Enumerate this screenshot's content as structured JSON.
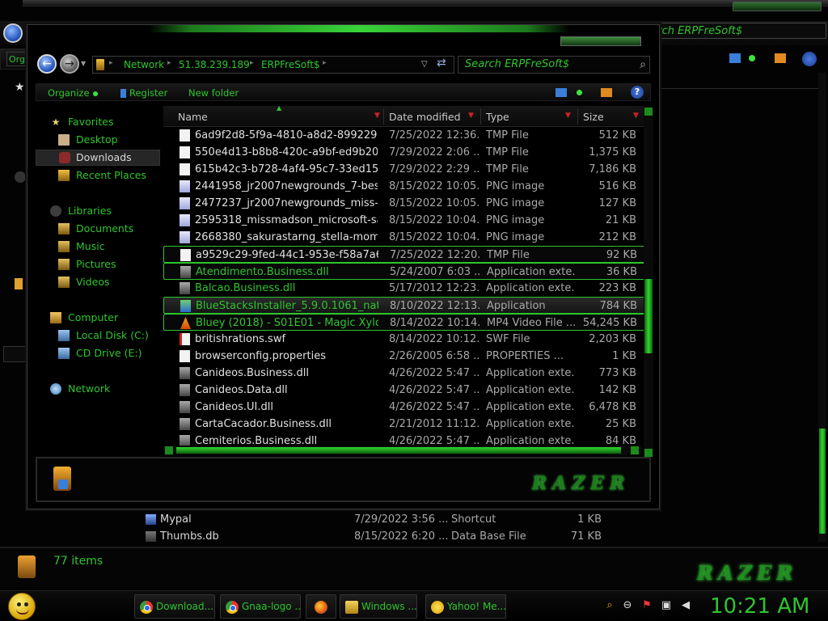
{
  "background_window": {
    "search_text": "Search ERPFreSoft$",
    "organize_fragment": "Org",
    "status_count": "77 items",
    "logo_text": "RAZER",
    "files": [
      {
        "name": "Mypal",
        "date": "7/29/2022 3:56 ...",
        "type": "Shortcut",
        "size": "1 KB"
      },
      {
        "name": "Thumbs.db",
        "date": "8/15/2022 6:20 ...",
        "type": "Data Base File",
        "size": "71 KB"
      }
    ]
  },
  "window": {
    "address": {
      "crumbs": [
        "Network",
        "51.38.239.189",
        "ERPFreSoft$"
      ]
    },
    "search_placeholder": "Search ERPFreSoft$",
    "toolbar": {
      "organize": "Organize",
      "register": "Register",
      "new_folder": "New folder",
      "help": "?"
    },
    "nav": {
      "favorites": "Favorites",
      "desktop": "Desktop",
      "downloads": "Downloads",
      "recent": "Recent Places",
      "libraries": "Libraries",
      "documents": "Documents",
      "music": "Music",
      "pictures": "Pictures",
      "videos": "Videos",
      "computer": "Computer",
      "local_disk": "Local Disk (C:)",
      "cd_drive": "CD Drive (E:)",
      "network": "Network"
    },
    "columns": {
      "name": "Name",
      "date": "Date modified",
      "type": "Type",
      "size": "Size"
    },
    "files": [
      {
        "name": "6ad9f2d8-5f9a-4810-a8d2-899229a42...",
        "date": "7/25/2022 12:36...",
        "type": "TMP File",
        "size": "512 KB"
      },
      {
        "name": "550e4d13-b8b8-420c-a9bf-ed9b206a...",
        "date": "7/29/2022 2:06 ...",
        "type": "TMP File",
        "size": "1,375 KB"
      },
      {
        "name": "615b42c3-b728-4af4-95c7-33ed1561...",
        "date": "7/29/2022 2:29 ...",
        "type": "TMP File",
        "size": "7,186 KB"
      },
      {
        "name": "2441958_jr2007newgrounds_7-bestie...",
        "date": "8/15/2022 10:05...",
        "type": "PNG image",
        "size": "516 KB"
      },
      {
        "name": "2477237_jr2007newgrounds_miss-m...",
        "date": "8/15/2022 10:05...",
        "type": "PNG image",
        "size": "127 KB"
      },
      {
        "name": "2595318_missmadson_microsoft-sa...",
        "date": "8/15/2022 10:04...",
        "type": "PNG image",
        "size": "21 KB"
      },
      {
        "name": "2668380_sakurastarng_stella-momo...",
        "date": "8/15/2022 10:04...",
        "type": "PNG image",
        "size": "212 KB"
      },
      {
        "name": "a9529c29-9fed-44c1-953e-f58a7a61...",
        "date": "7/25/2022 12:20...",
        "type": "TMP File",
        "size": "92 KB"
      },
      {
        "name": "Atendimento.Business.dll",
        "date": "5/24/2007 6:03 ...",
        "type": "Application exte...",
        "size": "36 KB"
      },
      {
        "name": "Balcao.Business.dll",
        "date": "5/17/2012 12:23...",
        "type": "Application exte...",
        "size": "223 KB"
      },
      {
        "name": "BlueStacksInstaller_5.9.0.1061_nativ...",
        "date": "8/10/2022 12:13...",
        "type": "Application",
        "size": "784 KB"
      },
      {
        "name": "Bluey (2018) - S01E01 - Magic Xylop...",
        "date": "8/14/2022 10:14...",
        "type": "MP4 Video File ...",
        "size": "54,245 KB"
      },
      {
        "name": "britishrations.swf",
        "date": "8/14/2022 10:12...",
        "type": "SWF File",
        "size": "2,203 KB"
      },
      {
        "name": "browserconfig.properties",
        "date": "2/26/2005 6:58 ...",
        "type": "PROPERTIES ...",
        "size": "1 KB"
      },
      {
        "name": "Canideos.Business.dll",
        "date": "4/26/2022 5:47 ...",
        "type": "Application exte...",
        "size": "773 KB"
      },
      {
        "name": "Canideos.Data.dll",
        "date": "4/26/2022 5:47 ...",
        "type": "Application exte...",
        "size": "142 KB"
      },
      {
        "name": "Canideos.UI.dll",
        "date": "4/26/2022 5:47 ...",
        "type": "Application exte...",
        "size": "6,478 KB"
      },
      {
        "name": "CartaCacador.Business.dll",
        "date": "2/21/2012 11:12...",
        "type": "Application exte...",
        "size": "25 KB"
      },
      {
        "name": "Cemiterios.Business.dll",
        "date": "4/26/2022 5:47 ...",
        "type": "Application exte...",
        "size": "84 KB"
      }
    ],
    "logo_text": "RAZER"
  },
  "taskbar": {
    "buttons": [
      {
        "label": "Download...",
        "icon": "chrome-icon"
      },
      {
        "label": "Gnaa-logo ...",
        "icon": "chrome-icon"
      },
      {
        "label": "Windows ...",
        "icon": "folder-icon"
      },
      {
        "label": "Yahoo! Me...",
        "icon": "yahoo-messenger-icon"
      }
    ],
    "clock": "10:21 AM"
  },
  "colors": {
    "accent": "#2ec52e",
    "background": "#000000",
    "text": "#d8d8d8"
  }
}
